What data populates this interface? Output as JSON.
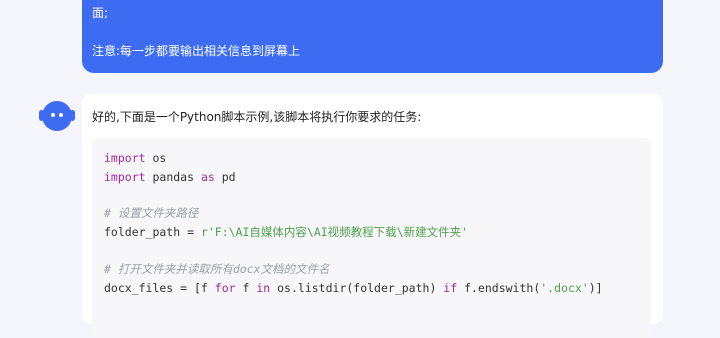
{
  "user_message": {
    "line1": "面;",
    "line2": "注意:每一步都要输出相关信息到屏幕上"
  },
  "assistant": {
    "avatar_icon": "robot-icon",
    "intro": "好的,下面是一个Python脚本示例,该脚本将执行你要求的任务:",
    "code": {
      "l1_kw": "import",
      "l1_rest": " os",
      "l2_kw": "import",
      "l2_mid": " pandas ",
      "l2_kw2": "as",
      "l2_rest": " pd",
      "l4_comment": "# 设置文件夹路径",
      "l5_pre": "folder_path = ",
      "l5_str": "r'F:\\AI自媒体内容\\AI视频教程下载\\新建文件夹'",
      "l7_comment": "# 打开文件夹并读取所有docx文档的文件名",
      "l8_pre": "docx_files = [f ",
      "l8_kw1": "for",
      "l8_mid1": " f ",
      "l8_kw2": "in",
      "l8_mid2": " os.listdir(folder_path) ",
      "l8_kw3": "if",
      "l8_mid3": " f.endswith(",
      "l8_str": "'.docx'",
      "l8_end": ")]"
    }
  },
  "colors": {
    "accent": "#3d6cf2",
    "keyword": "#a626a4",
    "comment": "#9aa0a6",
    "string": "#50a14f"
  }
}
